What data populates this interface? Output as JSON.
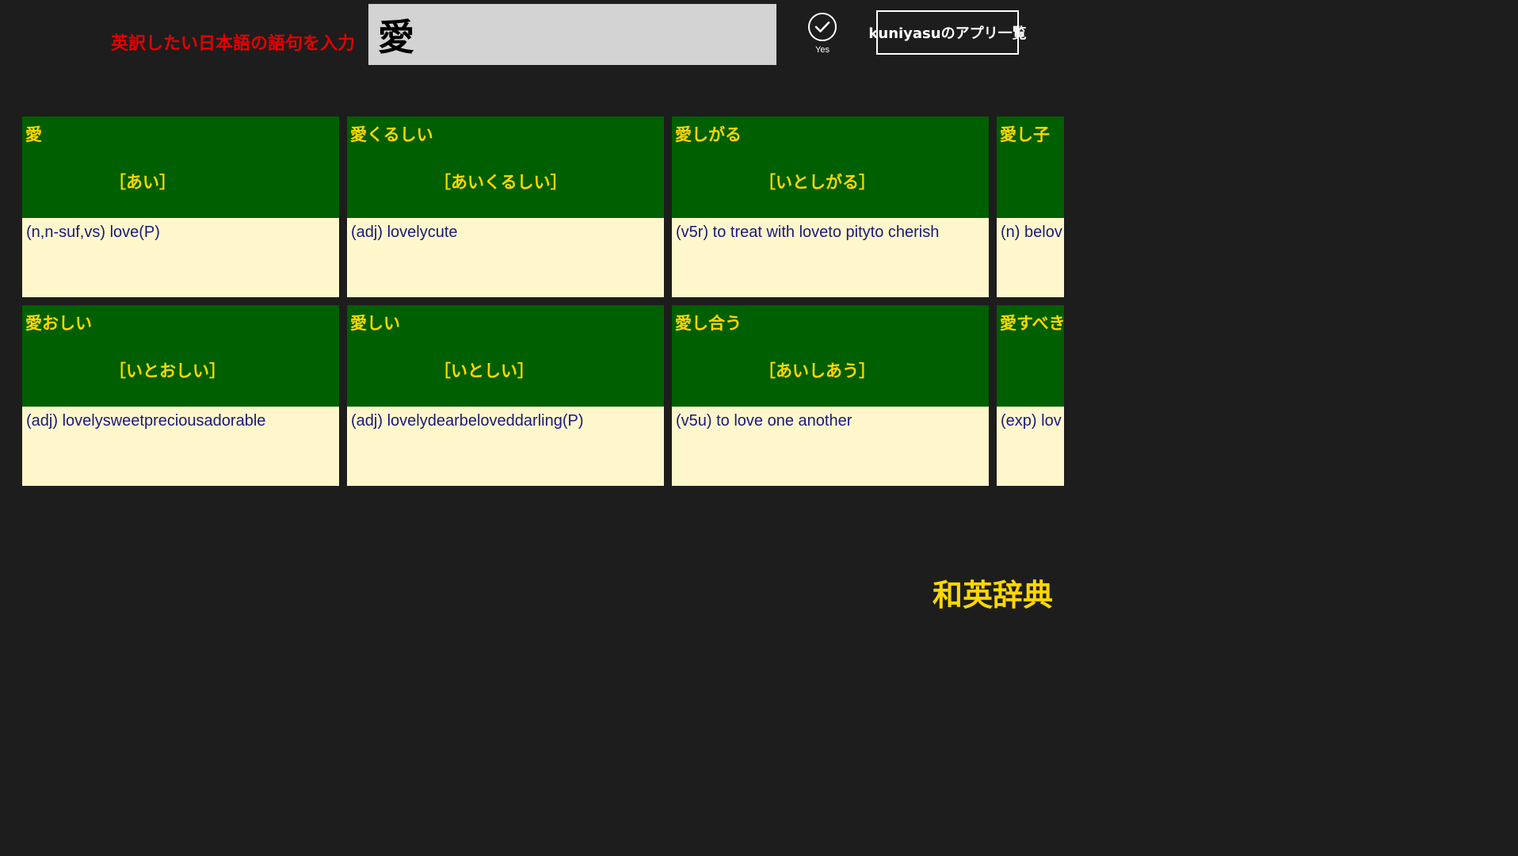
{
  "header": {
    "prompt_label": "英訳したい日本語の語句を入力",
    "search_value": "愛",
    "yes_label": "Yes",
    "apps_button_label": "kuniyasuのアプリ一覧"
  },
  "entries": [
    {
      "word": "愛",
      "reading": "［あい］",
      "definition": "(n,n-suf,vs) love(P)"
    },
    {
      "word": "愛くるしい",
      "reading": "［あいくるしい］",
      "definition": "(adj) lovelycute"
    },
    {
      "word": "愛しがる",
      "reading": "［いとしがる］",
      "definition": "(v5r) to treat with loveto pityto cherish"
    },
    {
      "word": "愛し子",
      "reading": "",
      "definition": "(n) belov"
    },
    {
      "word": "愛おしい",
      "reading": "［いとおしい］",
      "definition": "(adj) lovelysweetpreciousadorable"
    },
    {
      "word": "愛しい",
      "reading": "［いとしい］",
      "definition": "(adj) lovelydearbeloveddarling(P)"
    },
    {
      "word": "愛し合う",
      "reading": "［あいしあう］",
      "definition": "(v5u) to love one another"
    },
    {
      "word": "愛すべき",
      "reading": "",
      "definition": "(exp) lov"
    }
  ],
  "footer": {
    "app_title": "和英辞典"
  },
  "colors": {
    "background": "#1d1d1d",
    "prompt_red": "#e40000",
    "card_header_green": "#005f00",
    "card_text_gold": "#ffd700",
    "card_body_cream": "#fff7cc",
    "definition_navy": "#1a1a7a"
  },
  "icons": {
    "yes": "check-circle-icon"
  }
}
